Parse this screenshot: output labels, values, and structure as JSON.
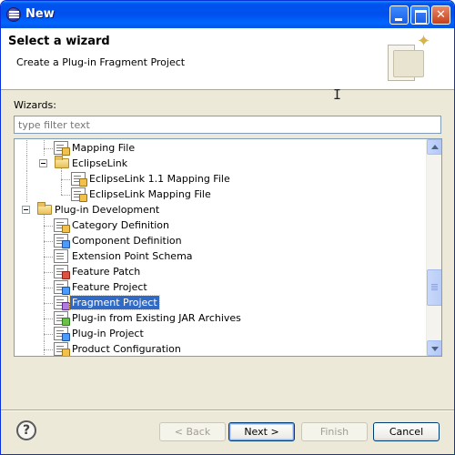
{
  "window": {
    "title": "New",
    "icon": "eclipse-icon"
  },
  "banner": {
    "title": "Select a wizard",
    "description": "Create a Plug-in Fragment Project",
    "image": "wizard-banner-icon"
  },
  "wizards_label": "Wizards:",
  "filter": {
    "placeholder": "type filter text",
    "value": ""
  },
  "tree": {
    "items": [
      {
        "label": "Mapping File",
        "icon": "mapping-file-icon",
        "selected": false
      },
      {
        "label": "EclipseLink",
        "icon": "folder-open-icon",
        "expanded": true
      },
      {
        "label": "EclipseLink 1.1 Mapping File",
        "icon": "mapping-file-icon",
        "selected": false
      },
      {
        "label": "EclipseLink Mapping File",
        "icon": "mapping-file-icon",
        "selected": false
      },
      {
        "label": "Plug-in Development",
        "icon": "folder-open-icon",
        "expanded": true
      },
      {
        "label": "Category Definition",
        "icon": "category-icon",
        "selected": false
      },
      {
        "label": "Component Definition",
        "icon": "component-icon",
        "selected": false
      },
      {
        "label": "Extension Point Schema",
        "icon": "schema-icon",
        "selected": false
      },
      {
        "label": "Feature Patch",
        "icon": "feature-patch-icon",
        "selected": false
      },
      {
        "label": "Feature Project",
        "icon": "feature-project-icon",
        "selected": false
      },
      {
        "label": "Fragment Project",
        "icon": "fragment-project-icon",
        "selected": true
      },
      {
        "label": "Plug-in from Existing JAR Archives",
        "icon": "jar-plugin-icon",
        "selected": false
      },
      {
        "label": "Plug-in Project",
        "icon": "plugin-project-icon",
        "selected": false
      },
      {
        "label": "Product Configuration",
        "icon": "product-config-icon",
        "selected": false
      }
    ]
  },
  "buttons": {
    "help": "?",
    "back": "< Back",
    "next": "Next >",
    "finish": "Finish",
    "cancel": "Cancel"
  },
  "colors": {
    "titlebar": "#0054e3",
    "selection": "#316ac5",
    "dialog_bg": "#ece9d8"
  }
}
